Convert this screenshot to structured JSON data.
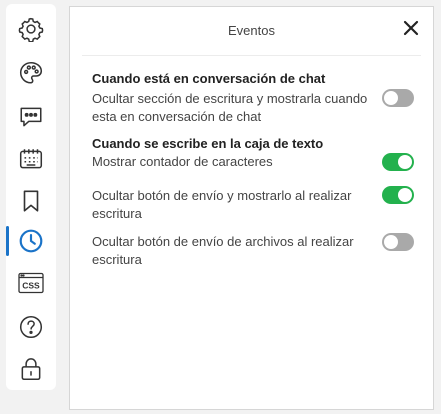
{
  "sidebar": {
    "items": [
      {
        "icon": "gear-icon",
        "active": false
      },
      {
        "icon": "palette-icon",
        "active": false
      },
      {
        "icon": "chat-bubble-icon",
        "active": false
      },
      {
        "icon": "keyboard-icon",
        "active": false
      },
      {
        "icon": "bookmark-icon",
        "active": false
      },
      {
        "icon": "clock-icon",
        "active": true
      },
      {
        "icon": "css-icon",
        "active": false,
        "text": "CSS"
      },
      {
        "icon": "help-icon",
        "active": false
      },
      {
        "icon": "lock-icon",
        "active": false
      }
    ],
    "active_color": "#1a73c8"
  },
  "panel": {
    "title": "Eventos",
    "close_icon": "close-icon",
    "sections": [
      {
        "title": "Cuando está en conversación de chat",
        "options": [
          {
            "label": "Ocultar sección de escritura y mostrarla cuando esta en conversación de chat",
            "enabled": false
          }
        ]
      },
      {
        "title": "Cuando se escribe en la caja de texto",
        "options": [
          {
            "label": "Mostrar contador de caracteres",
            "enabled": true
          },
          {
            "label": "Ocultar botón de envío y mostrarlo al realizar escritura",
            "enabled": true
          },
          {
            "label": "Ocultar botón de envío de archivos al realizar escritura",
            "enabled": false
          }
        ]
      }
    ]
  },
  "colors": {
    "toggle_on": "#23b14d",
    "toggle_off": "#a9a9a9",
    "background": "#f2f2f2"
  }
}
